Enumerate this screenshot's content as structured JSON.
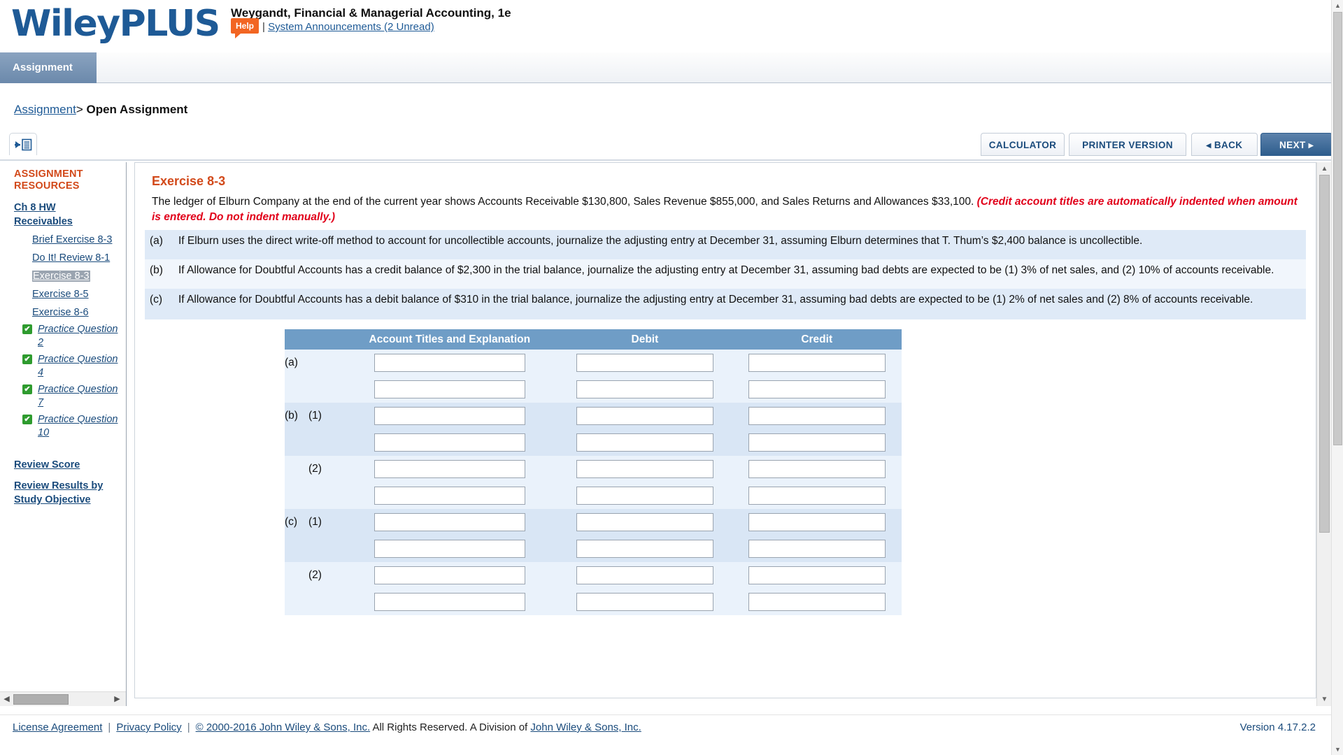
{
  "header": {
    "logo_wiley": "Wiley",
    "logo_plus": "PLUS",
    "course_title": "Weygandt, Financial & Managerial Accounting, 1e",
    "help_label": "Help",
    "separator": "|",
    "announcements_label": "System Announcements (2 Unread)"
  },
  "tabs": [
    {
      "label": "Assignment",
      "selected": true
    }
  ],
  "breadcrumb": {
    "root_label": "Assignment",
    "separator": ">",
    "current_label": "Open Assignment"
  },
  "toolbar": {
    "collapse_icon": "collapse-panel-icon",
    "calculator_label": "CALCULATOR",
    "printer_label": "PRINTER VERSION",
    "back_label": "◂ BACK",
    "next_label": "NEXT ▸"
  },
  "sidebar": {
    "title": "ASSIGNMENT RESOURCES",
    "chapter_link": "Ch 8 HW Receivables",
    "items": [
      {
        "label": "Brief Exercise 8-3",
        "selected": false
      },
      {
        "label": "Do It! Review 8-1",
        "selected": false
      },
      {
        "label": "Exercise 8-3",
        "selected": true
      },
      {
        "label": "Exercise 8-5",
        "selected": false
      },
      {
        "label": "Exercise 8-6",
        "selected": false
      }
    ],
    "practice_items": [
      {
        "label": "Practice Question 2",
        "completed": true
      },
      {
        "label": "Practice Question 4",
        "completed": true
      },
      {
        "label": "Practice Question 7",
        "completed": true
      },
      {
        "label": "Practice Question 10",
        "completed": true
      }
    ],
    "review_score_label": "Review Score",
    "review_results_label": "Review Results by Study Objective",
    "check_glyph": "✔"
  },
  "exercise": {
    "title": "Exercise 8-3",
    "intro_text": "The ledger of Elburn Company at the end of the current year shows Accounts Receivable $130,800, Sales Revenue $855,000, and Sales Returns and Allowances $33,100. ",
    "intro_note": "(Credit account titles are automatically indented when amount is entered. Do not indent manually.)",
    "parts": [
      {
        "label": "(a)",
        "text": "If Elburn uses the direct write-off method to account for uncollectible accounts, journalize the adjusting entry at December 31, assuming Elburn determines that T. Thum’s $2,400 balance is uncollectible."
      },
      {
        "label": "(b)",
        "text": "If Allowance for Doubtful Accounts has a credit balance of $2,300 in the trial balance, journalize the adjusting entry at December 31, assuming bad debts are expected to be (1) 3% of net sales, and (2) 10% of accounts receivable."
      },
      {
        "label": "(c)",
        "text": "If Allowance for Doubtful Accounts has a debit balance of $310 in the trial balance, journalize the adjusting entry at December 31, assuming bad debts are expected to be (1) 2% of net sales and (2) 8% of accounts receivable."
      }
    ]
  },
  "journal_table": {
    "headers": {
      "label_col": "",
      "account": "Account Titles and Explanation",
      "debit": "Debit",
      "credit": "Credit"
    },
    "rows": [
      {
        "outer": "(a)",
        "inner": "",
        "shade": "light",
        "account": "",
        "debit": "",
        "credit": ""
      },
      {
        "outer": "",
        "inner": "",
        "shade": "light",
        "account": "",
        "debit": "",
        "credit": ""
      },
      {
        "outer": "(b)",
        "inner": "(1)",
        "shade": "dark",
        "account": "",
        "debit": "",
        "credit": ""
      },
      {
        "outer": "",
        "inner": "",
        "shade": "dark",
        "account": "",
        "debit": "",
        "credit": ""
      },
      {
        "outer": "",
        "inner": "(2)",
        "shade": "light",
        "account": "",
        "debit": "",
        "credit": ""
      },
      {
        "outer": "",
        "inner": "",
        "shade": "light",
        "account": "",
        "debit": "",
        "credit": ""
      },
      {
        "outer": "(c)",
        "inner": "(1)",
        "shade": "dark",
        "account": "",
        "debit": "",
        "credit": ""
      },
      {
        "outer": "",
        "inner": "",
        "shade": "dark",
        "account": "",
        "debit": "",
        "credit": ""
      },
      {
        "outer": "",
        "inner": "(2)",
        "shade": "light",
        "account": "",
        "debit": "",
        "credit": ""
      },
      {
        "outer": "",
        "inner": "",
        "shade": "light",
        "account": "",
        "debit": "",
        "credit": ""
      }
    ]
  },
  "footer": {
    "license_label": "License Agreement",
    "privacy_label": "Privacy Policy",
    "copyright_link": "© 2000-2016 John Wiley & Sons, Inc.",
    "copyright_rest": " All Rights Reserved. A Division of ",
    "division_link": "John Wiley & Sons, Inc.",
    "version": "Version 4.17.2.2",
    "bar": "|"
  },
  "colors": {
    "brand_blue": "#1e5a96",
    "accent_orange": "#d2491a",
    "help_orange": "#f26522",
    "note_red": "#e1001a",
    "table_header_blue": "#6f9dc6",
    "check_green": "#2e9b2e"
  }
}
